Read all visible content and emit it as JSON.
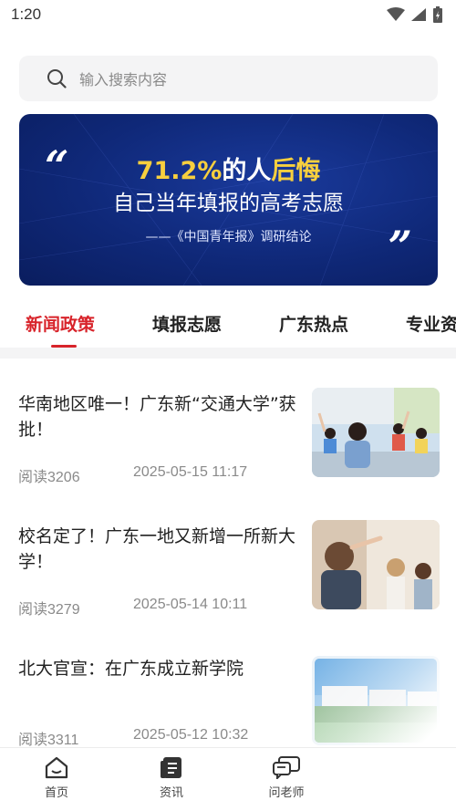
{
  "status_bar": {
    "time": "1:20"
  },
  "search": {
    "placeholder": "输入搜索内容"
  },
  "banner": {
    "pct": "71.2%",
    "line1_mid": "的人",
    "line1_end": "后悔",
    "line2": "自己当年填报的高考志愿",
    "source": "——《中国青年报》调研结论",
    "colors": {
      "background": "#0f2878",
      "highlight": "#f7cf3e"
    }
  },
  "tabs": [
    {
      "label": "新闻政策",
      "active": true
    },
    {
      "label": "填报志愿",
      "active": false
    },
    {
      "label": "广东热点",
      "active": false
    },
    {
      "label": "专业资",
      "active": false
    }
  ],
  "news": [
    {
      "title": "华南地区唯一！广东新“交通大学”获批！",
      "reads": "阅读3206",
      "date": "2025-05-15 11:17",
      "image": "classroom-raised-hands-photo"
    },
    {
      "title": "校名定了！广东一地又新增一所新大学！",
      "reads": "阅读3279",
      "date": "2025-05-14 10:11",
      "image": "lecture-hall-photo"
    },
    {
      "title": "北大官宣：在广东成立新学院",
      "reads": "阅读3311",
      "date": "2025-05-12 10:32",
      "image": "campus-building-photo"
    }
  ],
  "bottom_nav": [
    {
      "label": "首页",
      "icon": "home-icon"
    },
    {
      "label": "资讯",
      "icon": "news-icon"
    },
    {
      "label": "问老师",
      "icon": "chat-icon"
    }
  ],
  "accent_color": "#d8232a"
}
